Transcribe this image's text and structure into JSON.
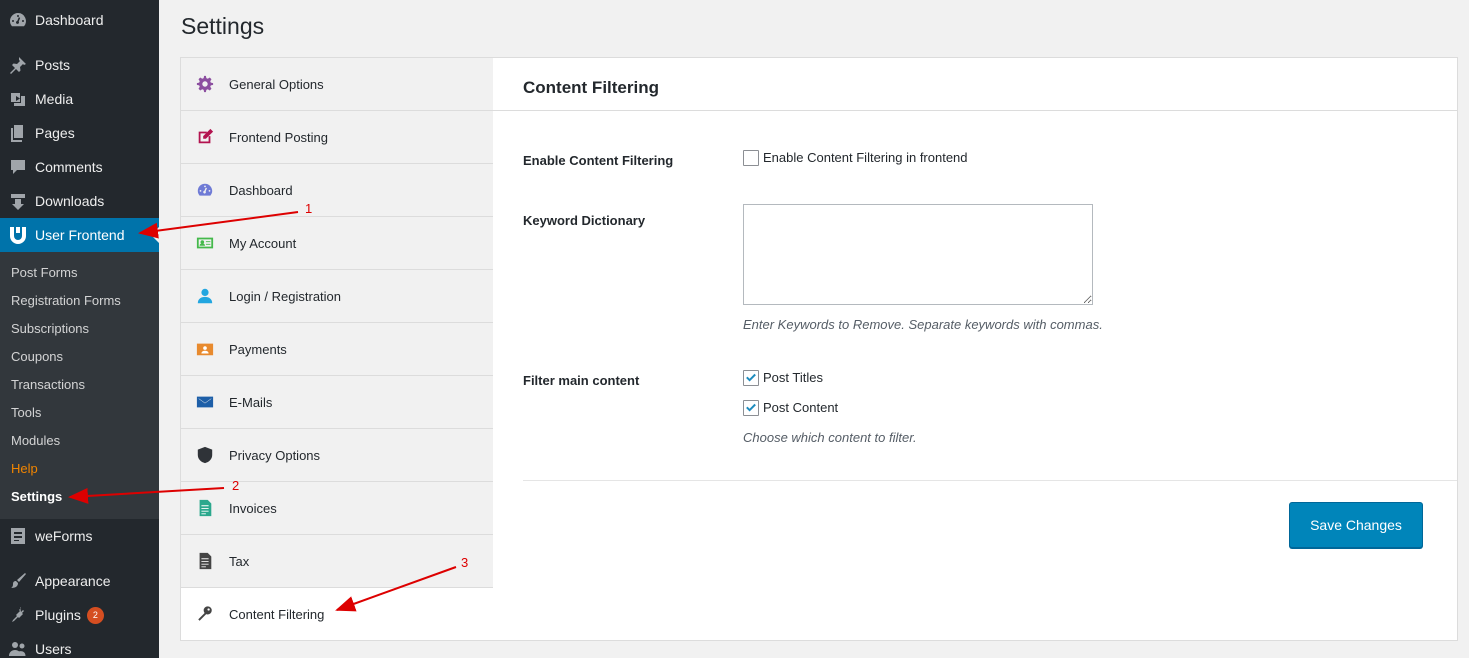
{
  "sidebar": {
    "dashboard": "Dashboard",
    "posts": "Posts",
    "media": "Media",
    "pages": "Pages",
    "comments": "Comments",
    "downloads": "Downloads",
    "user_frontend": "User Frontend",
    "submenu": [
      "Post Forms",
      "Registration Forms",
      "Subscriptions",
      "Coupons",
      "Transactions",
      "Tools",
      "Modules",
      "Help",
      "Settings"
    ],
    "weforms": "weForms",
    "appearance": "Appearance",
    "plugins": "Plugins",
    "plugins_badge": "2",
    "users": "Users"
  },
  "page": {
    "title": "Settings"
  },
  "settings_nav": [
    {
      "label": "General Options",
      "icon": "gear-icon",
      "color": "#8c4fa0"
    },
    {
      "label": "Frontend Posting",
      "icon": "edit-icon",
      "color": "#b3134f"
    },
    {
      "label": "Dashboard",
      "icon": "dashboard-icon",
      "color": "#6f7bd6"
    },
    {
      "label": "My Account",
      "icon": "id-card-icon",
      "color": "#44b94b"
    },
    {
      "label": "Login / Registration",
      "icon": "user-icon",
      "color": "#22a6e0"
    },
    {
      "label": "Payments",
      "icon": "payment-icon",
      "color": "#e88a2e"
    },
    {
      "label": "E-Mails",
      "icon": "envelope-icon",
      "color": "#1d5fa8"
    },
    {
      "label": "Privacy Options",
      "icon": "shield-icon",
      "color": "#2f3338"
    },
    {
      "label": "Invoices",
      "icon": "invoice-icon",
      "color": "#2ba88d"
    },
    {
      "label": "Tax",
      "icon": "tax-document-icon",
      "color": "#444444"
    },
    {
      "label": "Content Filtering",
      "icon": "key-icon",
      "color": "#444444"
    }
  ],
  "panel": {
    "title": "Content Filtering",
    "enable_label": "Enable Content Filtering",
    "enable_checkbox_label": "Enable Content Filtering in frontend",
    "enable_checked": false,
    "keyword_label": "Keyword Dictionary",
    "keyword_value": "",
    "keyword_desc": "Enter Keywords to Remove. Separate keywords with commas.",
    "filter_label": "Filter main content",
    "post_titles_label": "Post Titles",
    "post_titles_checked": true,
    "post_content_label": "Post Content",
    "post_content_checked": true,
    "filter_desc": "Choose which content to filter.",
    "save_label": "Save Changes"
  },
  "annotations": [
    "1",
    "2",
    "3"
  ],
  "colors": {
    "accent": "#0073aa",
    "button": "#0085ba",
    "annotation": "#dd0000"
  }
}
